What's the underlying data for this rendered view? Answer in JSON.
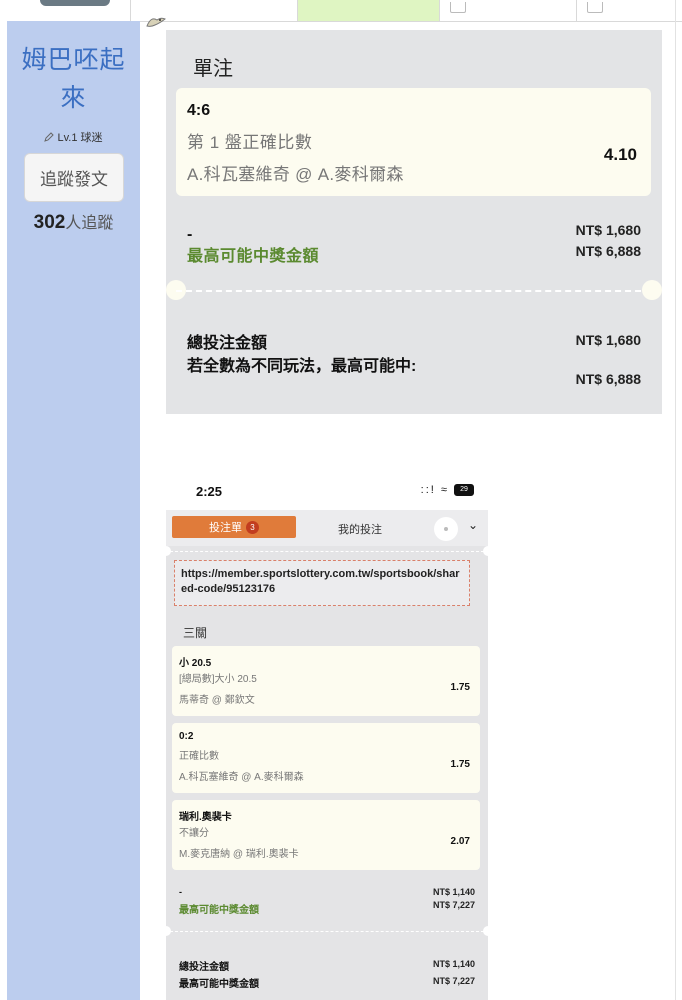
{
  "sidebar": {
    "author_line1": "姆巴呸起",
    "author_line2": "來",
    "level": "Lv.1 球迷",
    "follow_button": "追蹤發文",
    "followers_count": "302",
    "followers_suffix": "人追蹤",
    "accent_color": "#3b6fc2",
    "background_color": "#bccdee"
  },
  "bet_slip": {
    "title": "單注",
    "selection": {
      "score": "4:6",
      "market": "第 1 盤正確比數",
      "match": "A.科瓦塞維奇 @ A.麥科爾森",
      "odds": "4.10"
    },
    "stake_label": "-",
    "max_win_label": "最高可能中獎金額",
    "stake_amount": "NT$ 1,680",
    "max_win_amount": "NT$ 6,888",
    "total_stake_label": "總投注金額",
    "note_label": "若全數為不同玩法，最高可能中:",
    "total_stake_amount": "NT$ 1,680",
    "note_amount": "NT$ 6,888"
  },
  "phone": {
    "time": "2:25",
    "status_icons": "::! ≈",
    "battery": "29",
    "tab_betslip": "投注單",
    "tab_badge": "3",
    "tab_mybets": "我的投注",
    "chevron": "⌄",
    "share_url": "https://member.sportslottery.com.tw/sportsbook/shared-code/95123176",
    "parlay_label": "三關",
    "legs": [
      {
        "pick": "小 20.5",
        "market": "[總局數]大小 20.5",
        "match": "馬蒂奇 @ 鄭欽文",
        "odds": "1.75"
      },
      {
        "pick": "0:2",
        "market": "正確比數",
        "match": "A.科瓦塞維奇 @ A.麥科爾森",
        "odds": "1.75"
      },
      {
        "pick": "瑞利.奧裴卡",
        "market": "不讓分",
        "match": "M.麥克唐納 @ 瑞利.奧裴卡",
        "odds": "2.07"
      }
    ],
    "stake_label": "-",
    "max_win_label": "最高可能中獎金額",
    "stake_amount": "NT$ 1,140",
    "max_win_amount": "NT$ 7,227",
    "total_stake_label": "總投注金額",
    "total_max_win_label": "最高可能中獎金額",
    "total_stake_amount": "NT$ 1,140",
    "total_max_win_amount": "NT$ 7,227",
    "tab_color": "#e07b3a",
    "green_text_color": "#5b8a30"
  }
}
